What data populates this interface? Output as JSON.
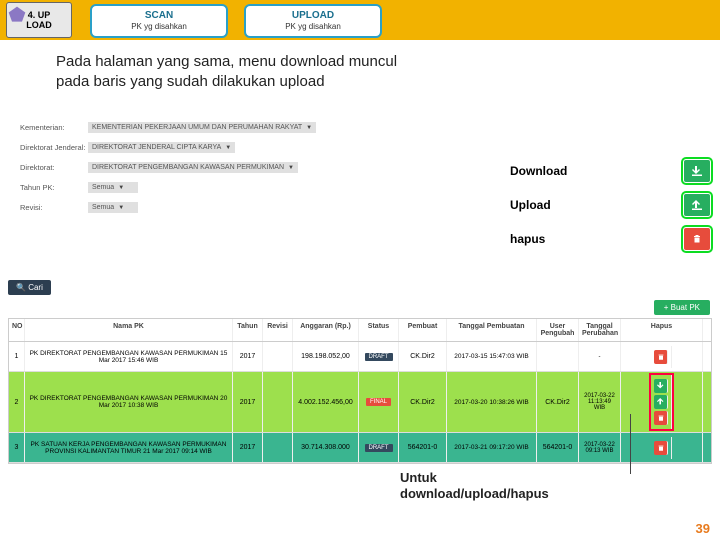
{
  "step": {
    "num": "4. UP",
    "name": "LOAD"
  },
  "pills": [
    {
      "t1": "SCAN",
      "t2": "PK yg disahkan"
    },
    {
      "t1": "UPLOAD",
      "t2": "PK yg disahkan"
    }
  ],
  "desc": "Pada halaman yang sama, menu download muncul\npada baris yang sudah dilakukan upload",
  "legend": {
    "download": "Download",
    "upload": "Upload",
    "hapus": "hapus"
  },
  "form": {
    "kementerian": {
      "label": "Kementerian:",
      "value": "KEMENTERIAN PEKERJAAN UMUM DAN PERUMAHAN RAKYAT"
    },
    "ditjen": {
      "label": "Direktorat Jenderal:",
      "value": "DIREKTORAT JENDERAL CIPTA KARYA"
    },
    "direktorat": {
      "label": "Direktorat:",
      "value": "DIREKTORAT PENGEMBANGAN KAWASAN PERMUKIMAN"
    },
    "tahun": {
      "label": "Tahun PK:",
      "value": "Semua"
    },
    "revisi": {
      "label": "Revisi:",
      "value": "Semua"
    }
  },
  "buttons": {
    "cari": "Cari",
    "buat": "+ Buat PK"
  },
  "columns": [
    "NO",
    "Nama PK",
    "Tahun",
    "Revisi",
    "Anggaran (Rp.)",
    "Status",
    "Pembuat",
    "Tanggal Pembuatan",
    "User Pengubah",
    "Tanggal Perubahan",
    "Hapus"
  ],
  "rows": [
    {
      "no": "1",
      "nama": "PK DIREKTORAT PENGEMBANGAN KAWASAN PERMUKIMAN 15 Mar 2017 15:46 WIB",
      "thn": "2017",
      "rev": "",
      "ang": "198.198.052,00",
      "stat": "DRAFT",
      "pemb": "CK.Dir2",
      "tgl": "2017-03-15 15:47:03 WIB",
      "user": "",
      "tglp": "-",
      "actions": [
        "del"
      ],
      "cls": ""
    },
    {
      "no": "2",
      "nama": "PK DIREKTORAT PENGEMBANGAN KAWASAN PERMUKIMAN 20 Mar 2017 10:38 WIB",
      "thn": "2017",
      "rev": "",
      "ang": "4.002.152.456,00",
      "stat": "FINAL",
      "pemb": "CK.Dir2",
      "tgl": "2017-03-20 10:38:26 WIB",
      "user": "CK.Dir2",
      "tglp": "2017-03-22 11:13:49 WIB",
      "actions": [
        "down",
        "up",
        "del"
      ],
      "cls": "row-green"
    },
    {
      "no": "3",
      "nama": "PK SATUAN KERJA PENGEMBANGAN KAWASAN PERMUKIMAN PROVINSI KALIMANTAN TIMUR 21 Mar 2017 09:14 WIB",
      "thn": "2017",
      "rev": "",
      "ang": "30.714.308.000",
      "stat": "DRAFT",
      "pemb": "564201-0",
      "tgl": "2017-03-21 09:17:20 WIB",
      "user": "564201-0",
      "tglp": "2017-03-22 09:13 WIB",
      "actions": [
        "del"
      ],
      "cls": "row-teal"
    }
  ],
  "footer": "Untuk\ndownload/upload/hapus",
  "page": "39"
}
